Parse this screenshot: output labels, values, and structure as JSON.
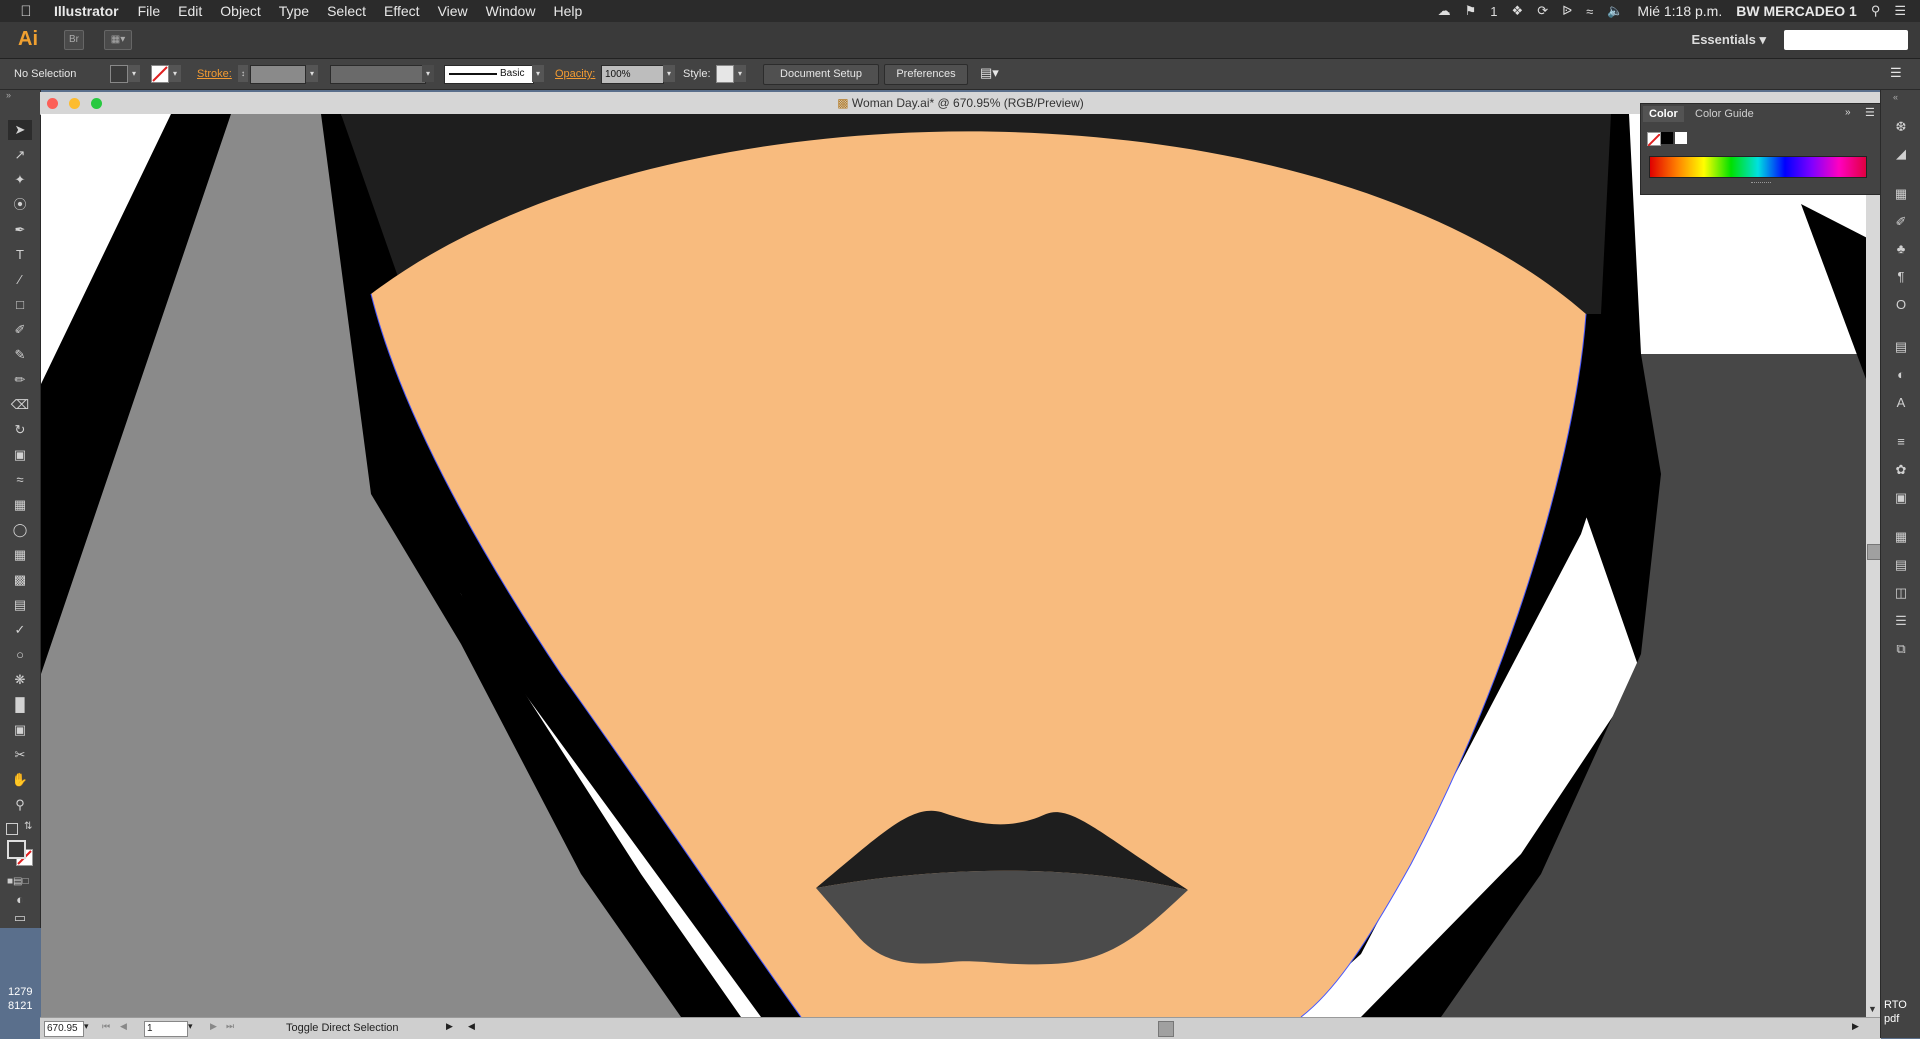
{
  "menubar": {
    "app_name": "Illustrator",
    "menus": [
      "File",
      "Edit",
      "Object",
      "Type",
      "Select",
      "Effect",
      "View",
      "Window",
      "Help"
    ],
    "tray_count": "1",
    "clock": "Mié 1:18 p.m.",
    "user": "BW MERCADEO 1"
  },
  "appbar": {
    "logo": "Ai",
    "bridge_label": "Br",
    "workspace": "Essentials"
  },
  "controlbar": {
    "selection": "No Selection",
    "stroke_label": "Stroke:",
    "brush_label": "Basic",
    "opacity_label": "Opacity:",
    "opacity_value": "100%",
    "style_label": "Style:",
    "document_setup": "Document Setup",
    "preferences": "Preferences"
  },
  "document": {
    "title": "Woman Day.ai* @ 670.95% (RGB/Preview)",
    "zoom": "670.95",
    "artboard": "1",
    "status": "Toggle Direct Selection"
  },
  "color_panel": {
    "tabs": [
      "Color",
      "Color Guide"
    ]
  },
  "desktop": {
    "left_text_1": "1279",
    "left_text_2": "8121",
    "right_text_1": "RTO",
    "right_text_2": "pdf"
  },
  "colors": {
    "skin": "#f8bb7e",
    "hair": "#1e1e1e",
    "outline": "#000000",
    "left_bg": "#8a8a8a",
    "right_bg": "#474747",
    "lip_upper": "#1e1e1e",
    "lip_lower": "#4b4b4b",
    "accent_orange": "#f39b32"
  }
}
